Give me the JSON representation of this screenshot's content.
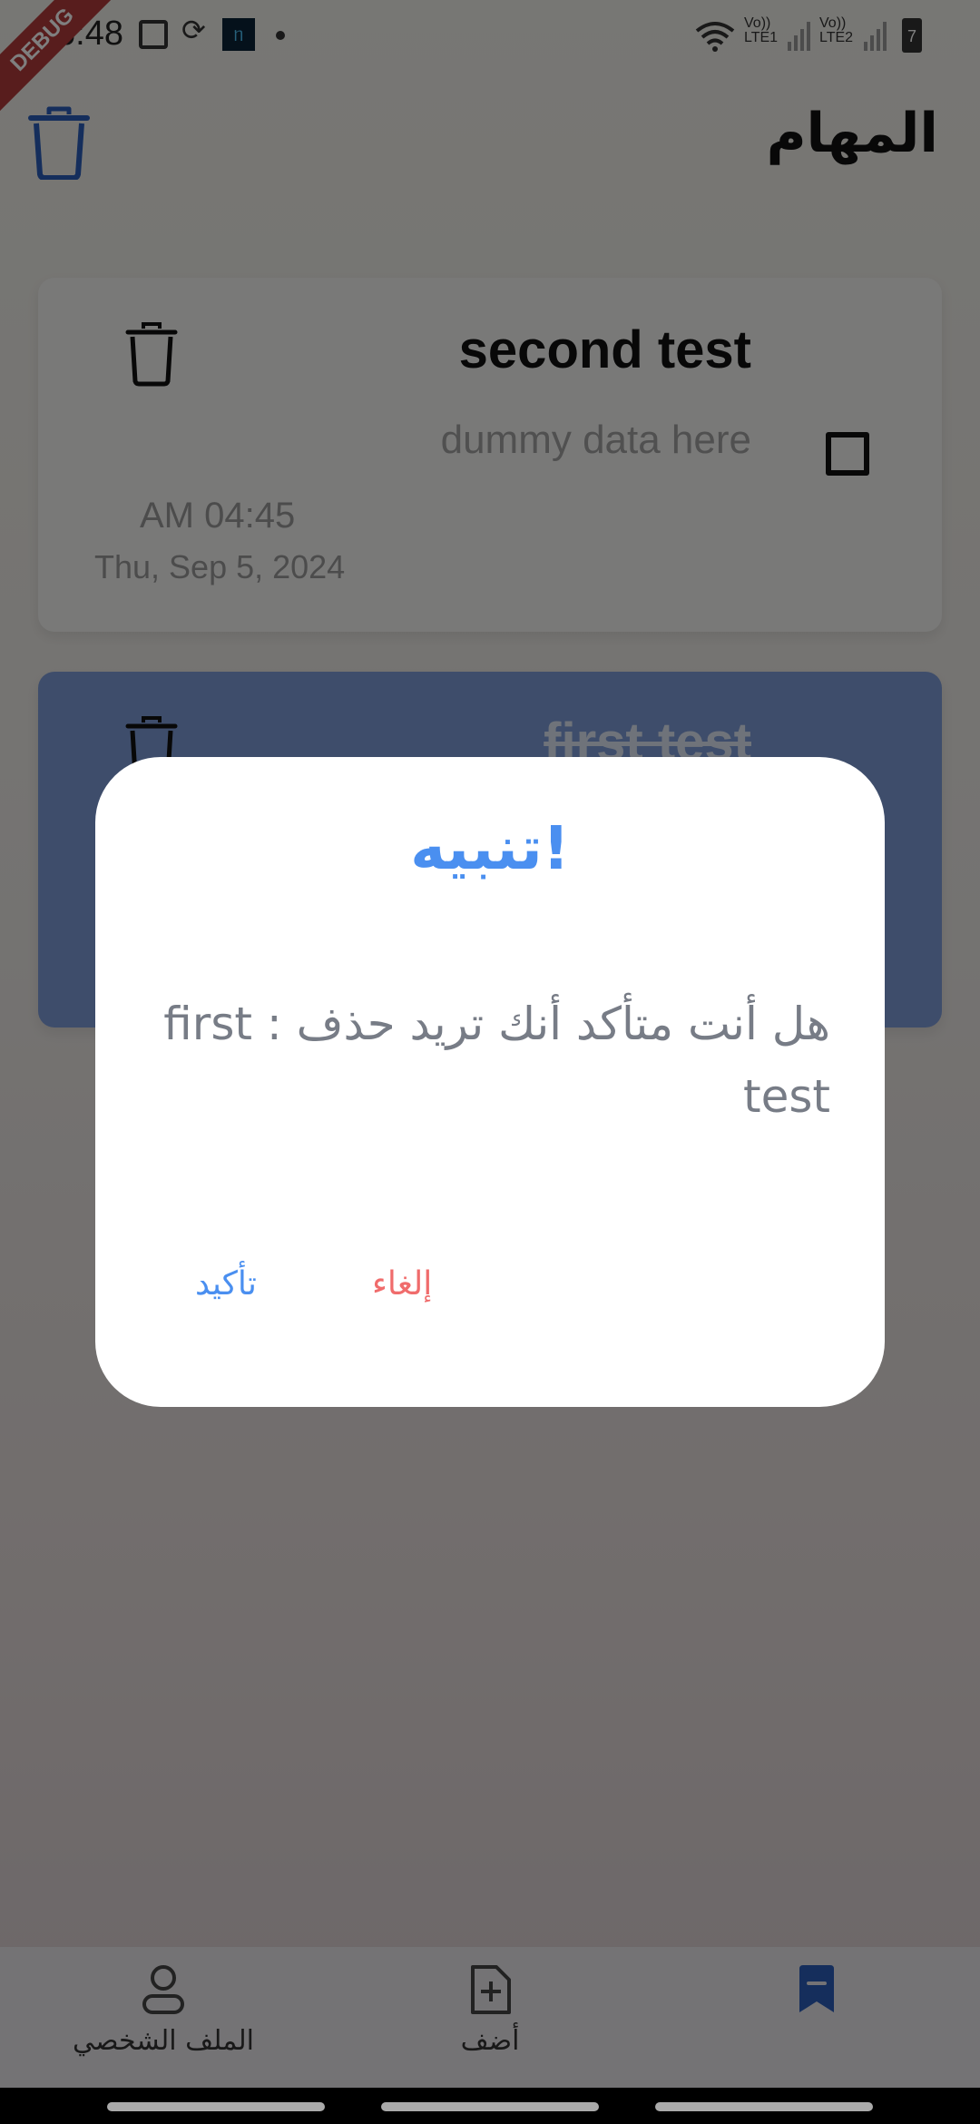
{
  "status_bar": {
    "time": "6:48",
    "debug_label": "DEBUG",
    "sim1_top": "Vo))",
    "sim1_bottom": "LTE1",
    "sim2_top": "Vo))",
    "sim2_bottom": "LTE2",
    "battery": "7"
  },
  "app_bar": {
    "title": "المهام"
  },
  "tasks": [
    {
      "title": "second test",
      "description": "dummy data here",
      "time": "AM 04:45",
      "date": "Thu, Sep 5, 2024",
      "completed": false,
      "color": "#f2f2f1"
    },
    {
      "title": "first test",
      "completed": true,
      "color": "#7d9bd6"
    }
  ],
  "dialog": {
    "title": "تنبيه!",
    "message": "هل أنت متأكد أنك تريد حذف : first test",
    "cancel_label": "إلغاء",
    "confirm_label": "تأكيد"
  },
  "bottom_nav": {
    "items": [
      {
        "label": "الملف الشخصي",
        "icon": "person-icon"
      },
      {
        "label": "أضف",
        "icon": "add-file-icon"
      },
      {
        "label": "",
        "icon": "bookmark-icon"
      }
    ]
  },
  "colors": {
    "accent": "#4a8ff0",
    "danger": "#f06c6c",
    "nav_active": "#2a5db8"
  }
}
